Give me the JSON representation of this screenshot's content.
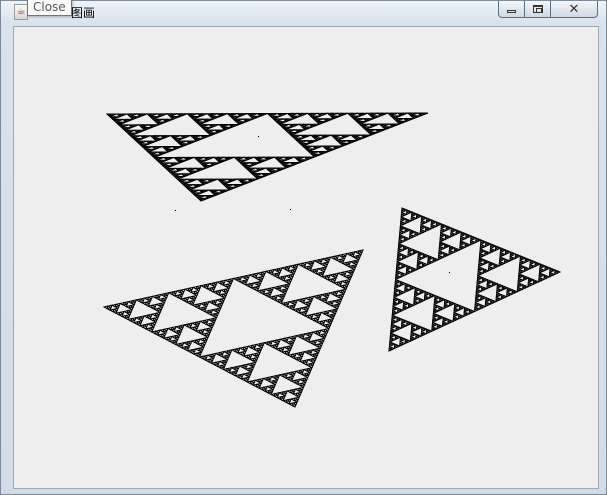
{
  "window": {
    "title": "图画",
    "tooltip": "Close",
    "icon": "java-app-icon",
    "controls": [
      "minimize",
      "maximize",
      "close"
    ]
  },
  "canvas": {
    "background": "#eeeeee",
    "fractal": "sierpinski-triangle",
    "fractal_color": "#000000",
    "triangle_count": 3
  }
}
